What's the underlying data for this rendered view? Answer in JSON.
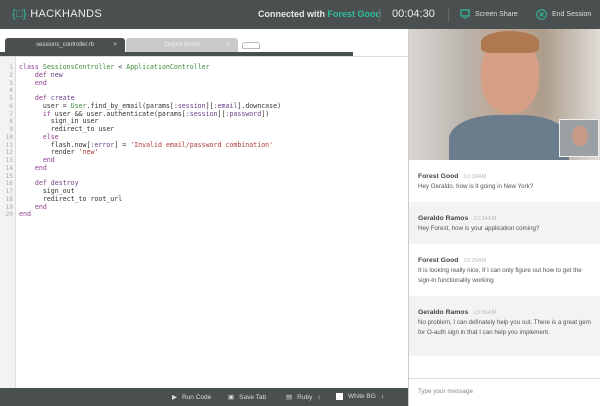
{
  "header": {
    "logo": "HACKHANDS",
    "connected_prefix": "Connected with",
    "connected_name": "Forest Good",
    "timer": "00:04:30",
    "screen_share": "Screen Share",
    "end_session": "End Session"
  },
  "tabs": [
    {
      "label": "sessions_controller.rb"
    },
    {
      "label": "Output errors"
    }
  ],
  "editor": {
    "lines": [
      "1",
      "2",
      "3",
      "4",
      "5",
      "6",
      "7",
      "8",
      "9",
      "10",
      "11",
      "12",
      "13",
      "14",
      "15",
      "16",
      "17",
      "18",
      "19",
      "20"
    ]
  },
  "toolbar": {
    "run": "Run Code",
    "save": "Save Tab",
    "language": "Ruby",
    "bg": "White BG"
  },
  "chat": {
    "messages": [
      {
        "name": "Forest Good",
        "time": "10:30AM",
        "text": "Hey Geraldo, how is it going in New York?"
      },
      {
        "name": "Geraldo Ramos",
        "time": "10:34AM",
        "text": "Hey Forest, how is your application coming?"
      },
      {
        "name": "Forest Good",
        "time": "10:35AM",
        "text": "It is looking really nice, If I can only figure out how to get the sign-in functionality working"
      },
      {
        "name": "Geraldo Ramos",
        "time": "10:36AM",
        "text": "No problem, I can definately help you out.  There is a great gem for O-auth sign in that I can help you implement."
      }
    ],
    "placeholder": "Type your message"
  },
  "colors": {
    "accent": "#2fbf9f",
    "bar": "#4a4f4f"
  }
}
